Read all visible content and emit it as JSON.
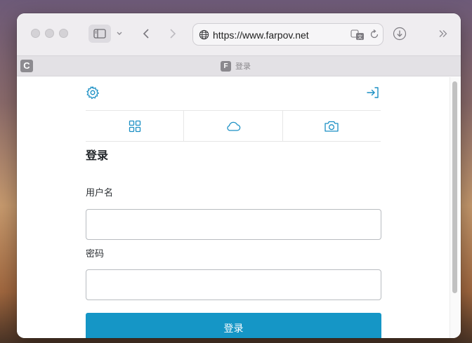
{
  "browser": {
    "url": "https://www.farpov.net",
    "tab_left_letter": "C",
    "tab_favicon_letter": "F",
    "tab_title": "登录"
  },
  "page": {
    "heading": "登录",
    "username_label": "用户名",
    "username_value": "",
    "password_label": "密码",
    "password_value": "",
    "submit_label": "登录"
  },
  "icons": {
    "settings": "gear-icon",
    "login": "sign-in-icon",
    "grid": "grid-icon",
    "cloud": "cloud-icon",
    "camera": "camera-icon"
  },
  "colors": {
    "accent": "#1596c6",
    "icon": "#1a8fc4"
  }
}
